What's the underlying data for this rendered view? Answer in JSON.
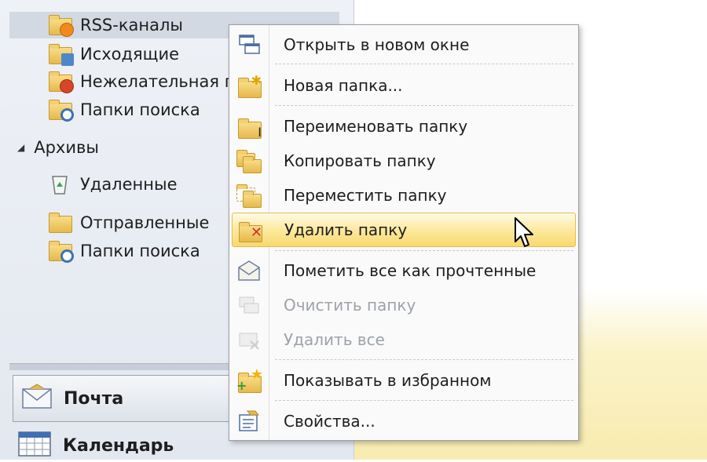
{
  "nav_pane": {
    "folders": [
      {
        "label": "RSS-каналы",
        "icon": "rss-folder-icon",
        "selected": true
      },
      {
        "label": "Исходящие",
        "icon": "outbox-folder-icon"
      },
      {
        "label": "Нежелательная п",
        "icon": "junk-folder-icon"
      },
      {
        "label": "Папки поиска",
        "icon": "search-folder-icon"
      }
    ],
    "archive_group": {
      "label": "Архивы",
      "expand_icon": "collapse-triangle-icon"
    },
    "archive_folders": [
      {
        "label": "Удаленные",
        "icon": "deleted-items-icon"
      },
      {
        "label": "Отправленные",
        "icon": "sent-folder-icon"
      },
      {
        "label": "Папки поиска",
        "icon": "search-folder-icon"
      }
    ],
    "modules": [
      {
        "label": "Почта",
        "icon": "mail-envelope-icon"
      },
      {
        "label": "Календарь",
        "icon": "calendar-icon"
      }
    ]
  },
  "context_menu": {
    "items": [
      {
        "label": "Открыть в новом окне",
        "icon": "open-new-window-icon",
        "enabled": true
      },
      {
        "label": "Новая папка...",
        "icon": "new-folder-icon",
        "enabled": true
      },
      {
        "label": "Переименовать папку",
        "icon": "rename-folder-icon",
        "enabled": true
      },
      {
        "label": "Копировать папку",
        "icon": "copy-folder-icon",
        "enabled": true
      },
      {
        "label": "Переместить папку",
        "icon": "move-folder-icon",
        "enabled": true
      },
      {
        "label": "Удалить папку",
        "icon": "delete-folder-icon",
        "enabled": true,
        "highlighted": true
      },
      {
        "label": "Пометить все как прочтенные",
        "icon": "mark-all-read-icon",
        "enabled": true
      },
      {
        "label": "Очистить папку",
        "icon": "clean-up-folder-icon",
        "enabled": false
      },
      {
        "label": "Удалить все",
        "icon": "delete-all-icon",
        "enabled": false
      },
      {
        "label": "Показывать в избранном",
        "icon": "favorites-star-icon",
        "enabled": true
      },
      {
        "label": "Свойства...",
        "icon": "properties-icon",
        "enabled": true
      }
    ]
  },
  "pointer": {
    "icon": "mouse-cursor-icon"
  },
  "colors": {
    "highlight": "#f8d96e",
    "disabled_text": "#9ea3aa",
    "folder": "#e6b94c"
  }
}
